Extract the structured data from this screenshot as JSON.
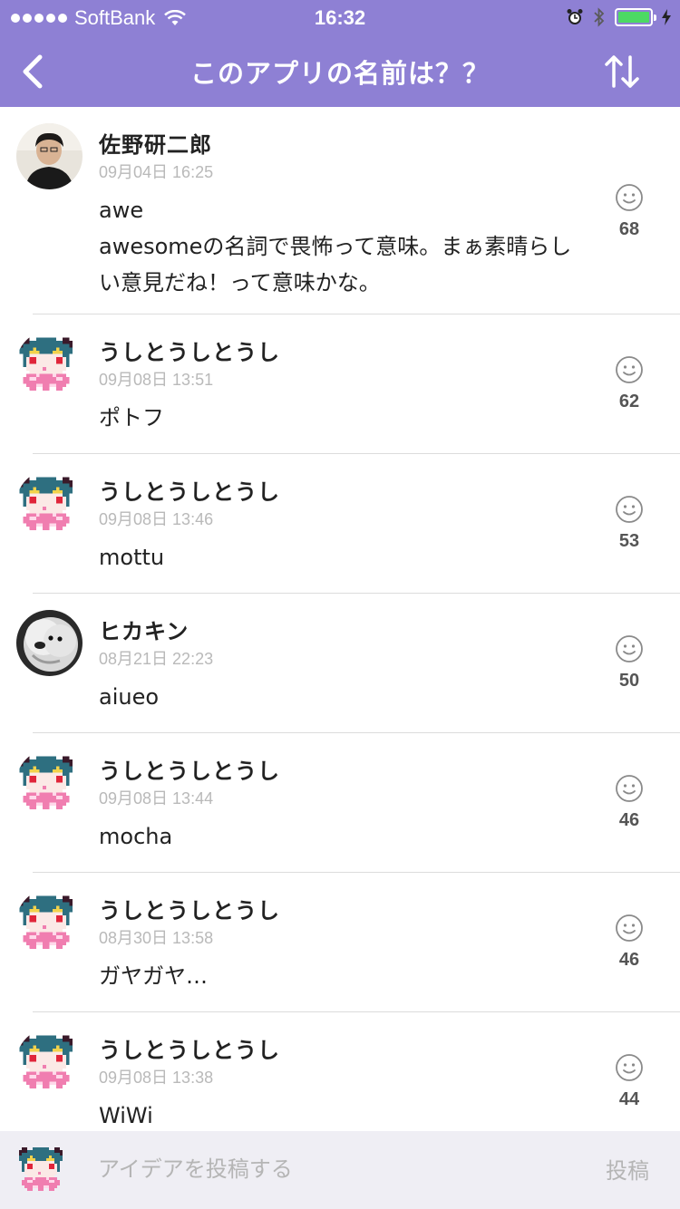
{
  "status_bar": {
    "carrier": "SoftBank",
    "time": "16:32",
    "battery_color": "#4cd964"
  },
  "nav": {
    "title": "このアプリの名前は？？",
    "back_icon": "chevron-left-icon",
    "sort_icon": "sort-arrows-icon",
    "background": "#8e80d4"
  },
  "posts": [
    {
      "user": "佐野研二郎",
      "date": "09月04日 16:25",
      "body": "awe\nawesomeの名詞で畏怖って意味。まぁ素晴らしい意見だね！って意味かな。",
      "likes": "68",
      "avatar": "photo-person"
    },
    {
      "user": "うしとうしとうし",
      "date": "09月08日 13:51",
      "body": "ポトフ",
      "likes": "62",
      "avatar": "pixel-character"
    },
    {
      "user": "うしとうしとうし",
      "date": "09月08日 13:46",
      "body": "mottu",
      "likes": "53",
      "avatar": "pixel-character"
    },
    {
      "user": "ヒカキン",
      "date": "08月21日 22:23",
      "body": "aiueo",
      "likes": "50",
      "avatar": "photo-dog"
    },
    {
      "user": "うしとうしとうし",
      "date": "09月08日 13:44",
      "body": "mocha",
      "likes": "46",
      "avatar": "pixel-character"
    },
    {
      "user": "うしとうしとうし",
      "date": "08月30日 13:58",
      "body": "ガヤガヤ…",
      "likes": "46",
      "avatar": "pixel-character"
    },
    {
      "user": "うしとうしとうし",
      "date": "09月08日 13:38",
      "body": "WiWi",
      "likes": "44",
      "avatar": "pixel-character"
    }
  ],
  "compose": {
    "placeholder": "アイデアを投稿する",
    "submit_label": "投稿",
    "avatar": "pixel-character"
  }
}
